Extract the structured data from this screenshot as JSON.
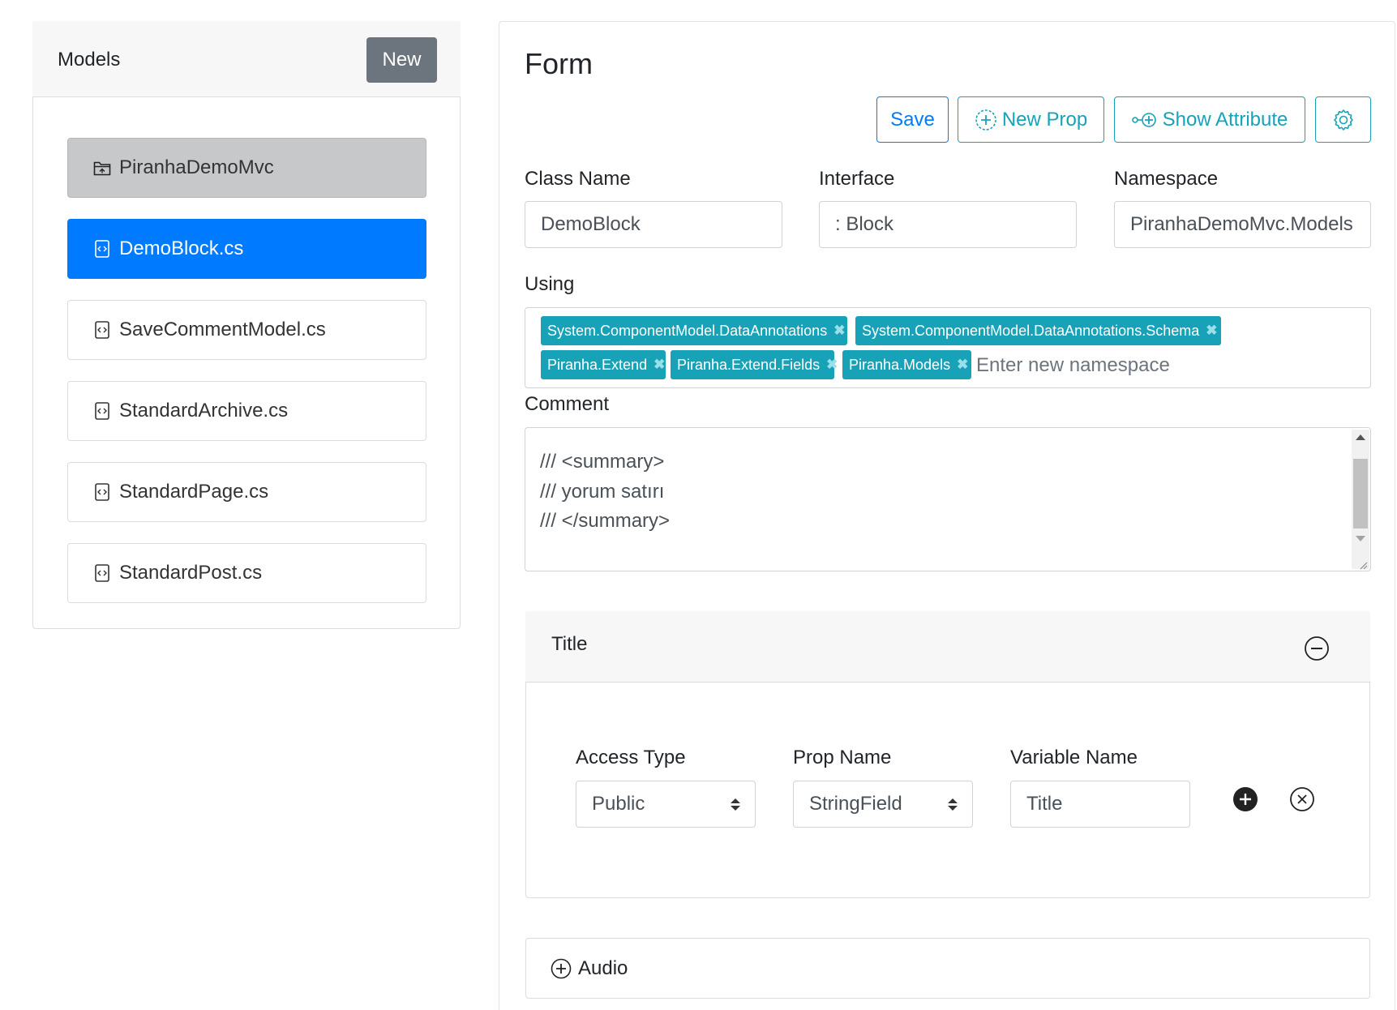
{
  "models_panel": {
    "title": "Models",
    "new_button": "New",
    "items": [
      {
        "label": "PiranhaDemoMvc",
        "icon": "folder-icon",
        "state": "folder"
      },
      {
        "label": "DemoBlock.cs",
        "icon": "code-file-icon",
        "state": "active"
      },
      {
        "label": "SaveCommentModel.cs",
        "icon": "code-file-icon",
        "state": "normal"
      },
      {
        "label": "StandardArchive.cs",
        "icon": "code-file-icon",
        "state": "normal"
      },
      {
        "label": "StandardPage.cs",
        "icon": "code-file-icon",
        "state": "normal"
      },
      {
        "label": "StandardPost.cs",
        "icon": "code-file-icon",
        "state": "normal"
      }
    ]
  },
  "form": {
    "title": "Form",
    "toolbar": {
      "save": "Save",
      "new_prop": "New Prop",
      "show_attribute": "Show Attribute",
      "settings_icon": "gear-icon"
    },
    "class_name": {
      "label": "Class Name",
      "value": "DemoBlock"
    },
    "interface": {
      "label": "Interface",
      "value": ": Block"
    },
    "namespace": {
      "label": "Namespace",
      "value": "PiranhaDemoMvc.Models"
    },
    "using": {
      "label": "Using",
      "tags": [
        "System.ComponentModel.DataAnnotations",
        "System.ComponentModel.DataAnnotations.Schema",
        "Piranha.Extend",
        "Piranha.Extend.Fields",
        "Piranha.Models"
      ],
      "placeholder": "Enter new namespace"
    },
    "comment": {
      "label": "Comment",
      "lines": [
        "/// <summary>",
        "/// yorum satırı",
        "/// </summary>"
      ]
    },
    "properties": [
      {
        "title": "Title",
        "expanded": true,
        "access_type": {
          "label": "Access Type",
          "value": "Public"
        },
        "prop_name": {
          "label": "Prop Name",
          "value": "StringField"
        },
        "variable_name": {
          "label": "Variable Name",
          "value": "Title"
        }
      },
      {
        "title": "Audio",
        "expanded": false
      }
    ]
  },
  "colors": {
    "primary": "#007bff",
    "info": "#17a2b8",
    "secondary": "#6c757d"
  }
}
